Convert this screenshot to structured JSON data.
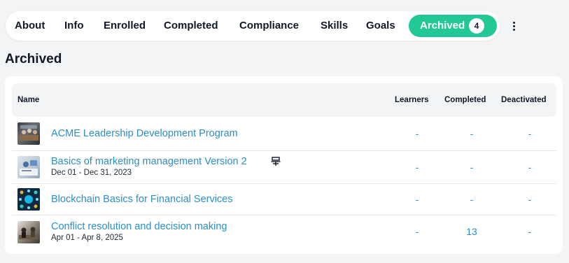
{
  "tabs": [
    {
      "label": "About"
    },
    {
      "label": "Info"
    },
    {
      "label": "Enrolled"
    },
    {
      "label": "Completed"
    },
    {
      "label": "Compliance"
    },
    {
      "label": "Skills"
    },
    {
      "label": "Goals"
    }
  ],
  "active_tab": {
    "label": "Archived",
    "count": "4"
  },
  "page_title": "Archived",
  "table": {
    "headers": {
      "name": "Name",
      "learners": "Learners",
      "completed": "Completed",
      "deactivated": "Deactivated"
    },
    "rows": [
      {
        "title": "ACME Leadership Development Program",
        "dates": "",
        "learners": "-",
        "completed": "-",
        "deactivated": "-"
      },
      {
        "title": "Basics of marketing management Version 2",
        "dates": "Dec 01 - Dec 31, 2023",
        "learners": "-",
        "completed": "-",
        "deactivated": "-"
      },
      {
        "title": "Blockchain Basics for Financial Services",
        "dates": "",
        "learners": "-",
        "completed": "-",
        "deactivated": "-"
      },
      {
        "title": "Conflict resolution and decision making",
        "dates": "Apr 01 - Apr 8, 2025",
        "learners": "-",
        "completed": "13",
        "deactivated": "-"
      }
    ]
  },
  "colors": {
    "accent": "#22c896",
    "link": "#2b8fc7"
  }
}
